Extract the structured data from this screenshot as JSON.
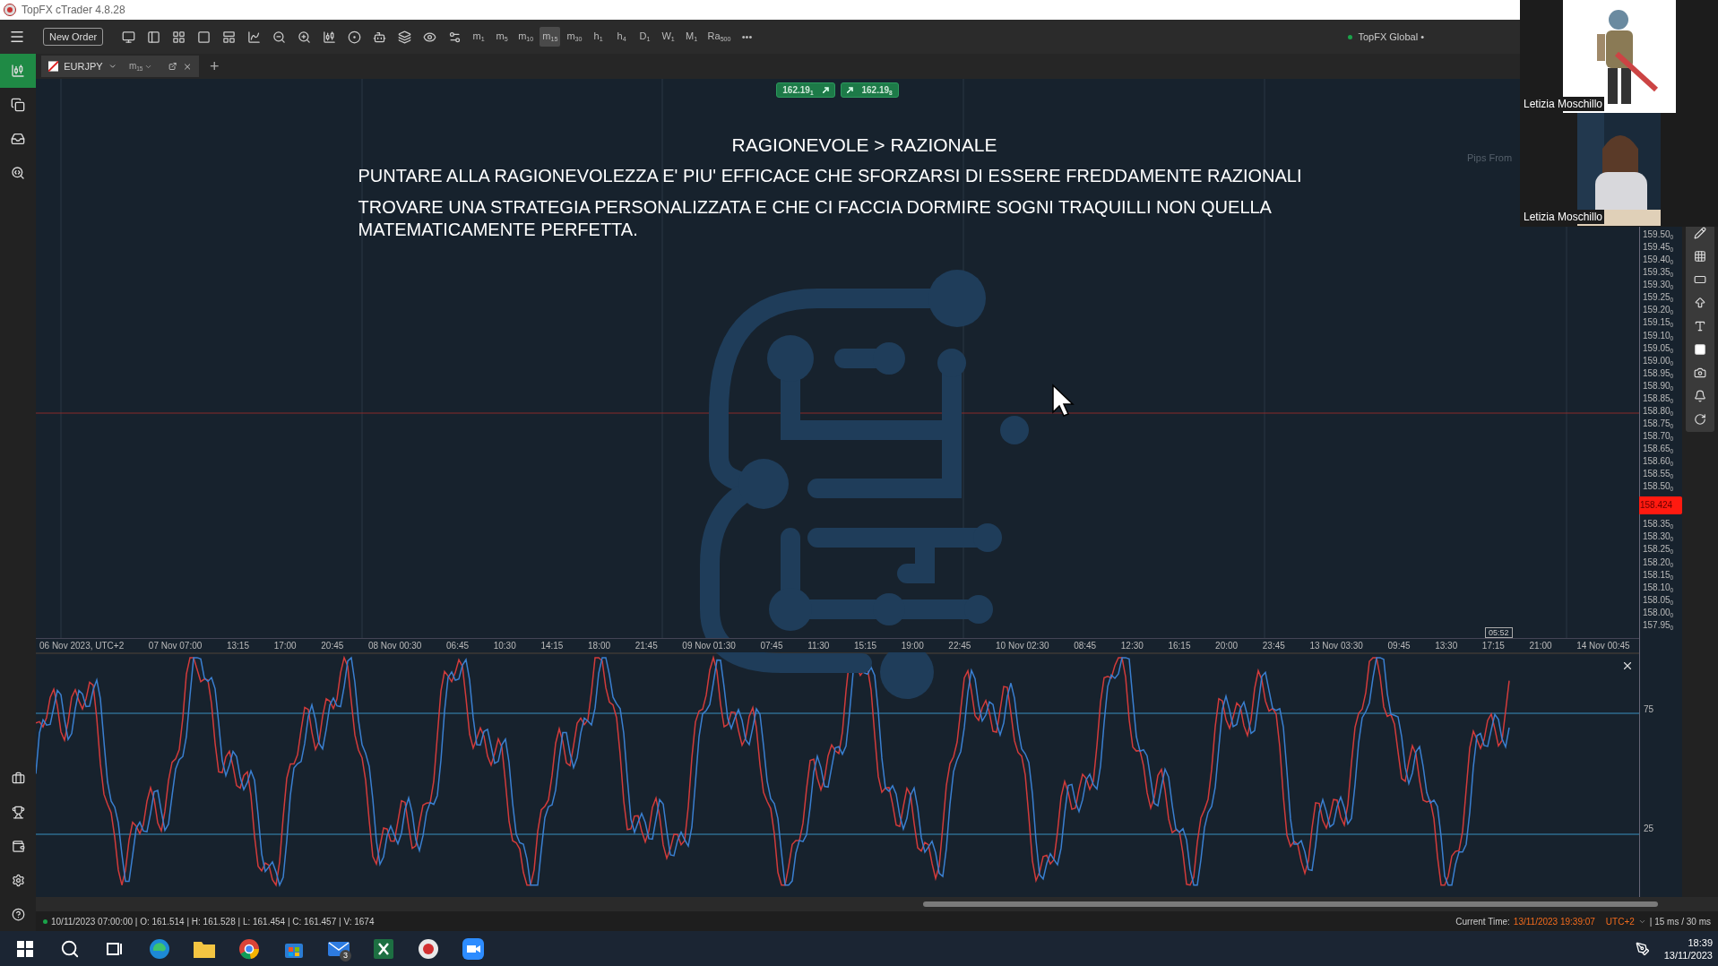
{
  "window": {
    "title": "TopFX cTrader 4.8.28"
  },
  "toolbar": {
    "new_order": "New Order",
    "timeframes": [
      {
        "label": "m$_{1}$",
        "selected": false
      },
      {
        "label": "m$_{5}$",
        "selected": false
      },
      {
        "label": "m$_{10}$",
        "selected": false
      },
      {
        "label": "m$_{15}$",
        "selected": true
      },
      {
        "label": "m$_{30}$",
        "selected": false
      },
      {
        "label": "h$_{1}$",
        "selected": false
      },
      {
        "label": "h$_{4}$",
        "selected": false
      },
      {
        "label": "D$_{1}$",
        "selected": false
      },
      {
        "label": "W$_{1}$",
        "selected": false
      },
      {
        "label": "M$_{1}$",
        "selected": false
      },
      {
        "label": "Ra$_{500}$",
        "selected": false
      }
    ],
    "more": "•••",
    "account": "TopFX Global •"
  },
  "sidebar": {
    "top": [
      {
        "selected": true
      },
      {
        "selected": false
      },
      {
        "selected": false
      },
      {
        "selected": false
      }
    ]
  },
  "chart_tab": {
    "symbol": "EURJPY",
    "timeframe": "m$_{15}$",
    "add": "+"
  },
  "quote": {
    "sell": "162.19$_{1}$",
    "buy": "162.19$_{8}$"
  },
  "slide": {
    "title": "RAGIONEVOLE > RAZIONALE",
    "lines": [
      "PUNTARE ALLA RAGIONEVOLEZZA E' PIU' EFFICACE CHE SFORZARSI DI ESSERE FREDDAMENTE RAZIONALI",
      "TROVARE UNA STRATEGIA PERSONALIZZATA E CHE CI FACCIA DORMIRE SOGNI TRAQUILLI NON QUELLA MATEMATICAMENTE PERFETTA."
    ]
  },
  "pips_label": "Pips From",
  "price_axis": [
    {
      "kind": "tick",
      "label": "159.50$_{0}$"
    },
    {
      "kind": "tick",
      "label": "159.45$_{0}$"
    },
    {
      "kind": "tick",
      "label": "159.40$_{0}$"
    },
    {
      "kind": "tick",
      "label": "159.35$_{0}$"
    },
    {
      "kind": "tick",
      "label": "159.30$_{0}$"
    },
    {
      "kind": "tick",
      "label": "159.25$_{0}$"
    },
    {
      "kind": "tick",
      "label": "159.20$_{0}$"
    },
    {
      "kind": "tick",
      "label": "159.15$_{0}$"
    },
    {
      "kind": "tick",
      "label": "159.10$_{0}$"
    },
    {
      "kind": "tick",
      "label": "159.05$_{0}$"
    },
    {
      "kind": "tick",
      "label": "159.00$_{0}$"
    },
    {
      "kind": "tick",
      "label": "158.95$_{0}$"
    },
    {
      "kind": "tick",
      "label": "158.90$_{0}$"
    },
    {
      "kind": "tick",
      "label": "158.85$_{0}$"
    },
    {
      "kind": "tick",
      "label": "158.80$_{0}$"
    },
    {
      "kind": "tick",
      "label": "158.75$_{0}$"
    },
    {
      "kind": "tick",
      "label": "158.70$_{0}$"
    },
    {
      "kind": "tick",
      "label": "158.65$_{0}$"
    },
    {
      "kind": "tick",
      "label": "158.60$_{0}$"
    },
    {
      "kind": "tick",
      "label": "158.55$_{0}$"
    },
    {
      "kind": "tick",
      "label": "158.50$_{0}$"
    },
    {
      "kind": "current",
      "label": "158.424"
    },
    {
      "kind": "tick",
      "label": "158.35$_{0}$"
    },
    {
      "kind": "tick",
      "label": "158.30$_{0}$"
    },
    {
      "kind": "tick",
      "label": "158.25$_{0}$"
    },
    {
      "kind": "tick",
      "label": "158.20$_{0}$"
    },
    {
      "kind": "tick",
      "label": "158.15$_{0}$"
    },
    {
      "kind": "tick",
      "label": "158.10$_{0}$"
    },
    {
      "kind": "tick",
      "label": "158.05$_{0}$"
    },
    {
      "kind": "tick",
      "label": "158.00$_{0}$"
    },
    {
      "kind": "tick",
      "label": "157.95$_{0}$"
    }
  ],
  "time_axis": [
    "06 Nov 2023, UTC+2",
    "07 Nov 07:00",
    "13:15",
    "17:00",
    "20:45",
    "08 Nov 00:30",
    "06:45",
    "10:30",
    "14:15",
    "18:00",
    "21:45",
    "09 Nov 01:30",
    "07:45",
    "11:30",
    "15:15",
    "19:00",
    "22:45",
    "10 Nov 02:30",
    "08:45",
    "12:30",
    "16:15",
    "20:00",
    "23:45",
    "13 Nov 03:30",
    "09:45",
    "13:30",
    "17:15",
    "21:00",
    "14 Nov 00:45"
  ],
  "time_marker": "05:52",
  "oscillator": {
    "ticks": [
      "75",
      "25"
    ]
  },
  "status_bar": {
    "bar_info": "10/11/2023 07:00:00 | O: 161.514 | H: 161.528 | L: 161.454 | C: 161.457 | V: 1674",
    "current_time_label": "Current Time:",
    "current_time": "13/11/2023 19:39:07",
    "timezone": "UTC+2",
    "latency": "| 15 ms / 30 ms"
  },
  "video": [
    {
      "name": "Letizia Moschillo",
      "kind": "figure"
    },
    {
      "name": "Letizia Moschillo",
      "kind": "room"
    }
  ],
  "taskbar": {
    "apps": [
      {
        "kind": "windows"
      },
      {
        "kind": "search"
      },
      {
        "kind": "taskview"
      },
      {
        "kind": "edge"
      },
      {
        "kind": "folder"
      },
      {
        "kind": "chrome"
      },
      {
        "kind": "store"
      },
      {
        "kind": "mail",
        "badge": "3"
      },
      {
        "kind": "excel"
      },
      {
        "kind": "ctrader"
      },
      {
        "kind": "zoom"
      }
    ],
    "time": "18:39",
    "date": "13/11/2023"
  }
}
